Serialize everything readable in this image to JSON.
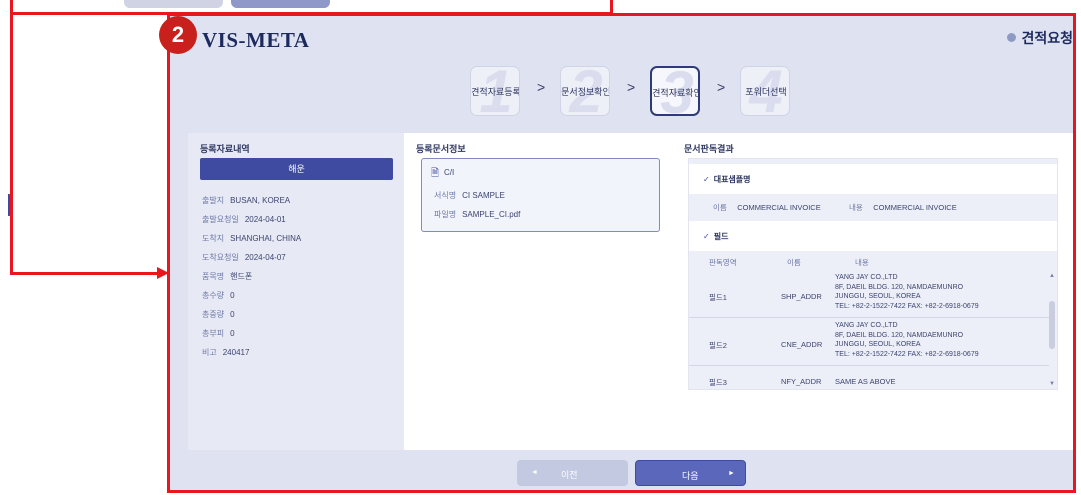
{
  "annotation": {
    "badge": "2"
  },
  "header": {
    "logo": "VIS-META",
    "quote_link": "견적요청"
  },
  "steps": [
    {
      "num": "1",
      "label": "견적자료등록"
    },
    {
      "num": "2",
      "label": "문서정보확인"
    },
    {
      "num": "3",
      "label": "견적자료확인"
    },
    {
      "num": "4",
      "label": "포워더선택"
    }
  ],
  "chevron": ">",
  "left_panel": {
    "title": "등록자료내역",
    "mode_button": "해운",
    "rows": [
      {
        "key": "출발지",
        "value": "BUSAN, KOREA"
      },
      {
        "key": "출발요청일",
        "value": "2024-04-01"
      },
      {
        "key": "도착지",
        "value": "SHANGHAI, CHINA"
      },
      {
        "key": "도착요청일",
        "value": "2024-04-07"
      },
      {
        "key": "품목명",
        "value": "핸드폰"
      },
      {
        "key": "총수량",
        "value": "0"
      },
      {
        "key": "총중량",
        "value": "0"
      },
      {
        "key": "총부피",
        "value": "0"
      },
      {
        "key": "비고",
        "value": "240417"
      }
    ]
  },
  "mid_panel": {
    "title": "등록문서정보",
    "doc_type": "C/I",
    "form_key": "서식명",
    "form_value": "CI SAMPLE",
    "file_key": "파일명",
    "file_value": "SAMPLE_CI.pdf"
  },
  "right_panel": {
    "title": "문서판독결과",
    "rep_section": "대표샘플명",
    "rep_name_key": "이름",
    "rep_name_value": "COMMERCIAL INVOICE",
    "rep_content_key": "내용",
    "rep_content_value": "COMMERCIAL INVOICE",
    "field_section": "필드",
    "columns": [
      "판독영역",
      "이름",
      "내용"
    ],
    "fields": [
      {
        "area": "필드1",
        "name": "SHP_ADDR",
        "lines": [
          "YANG JAY CO.,LTD",
          "8F, DAEIL BLDG. 120, NAMDAEMUNRO",
          "JUNGGU, SEOUL, KOREA",
          "TEL: +82-2-1522-7422 FAX: +82-2-6918-0679"
        ]
      },
      {
        "area": "필드2",
        "name": "CNE_ADDR",
        "lines": [
          "YANG JAY CO.,LTD",
          "8F, DAEIL BLDG. 120, NAMDAEMUNRO",
          "JUNGGU, SEOUL, KOREA",
          "TEL: +82-2-1522-7422 FAX: +82-2-6918-0679"
        ]
      },
      {
        "area": "필드3",
        "name": "NFY_ADDR",
        "lines": [
          "SAME AS ABOVE"
        ]
      }
    ]
  },
  "footer": {
    "prev": "이전",
    "next": "다음",
    "prev_arrow": "◄",
    "next_arrow": "►"
  }
}
